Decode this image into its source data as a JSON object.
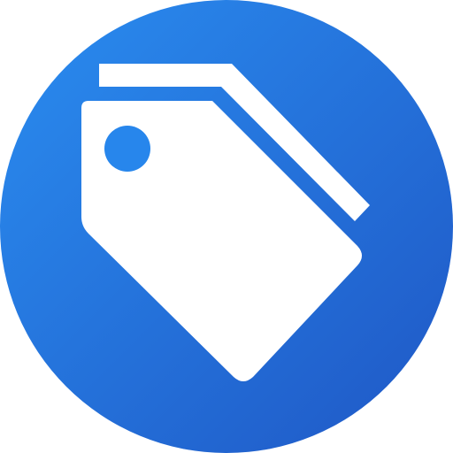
{
  "icon": {
    "name": "tags-icon",
    "description": "",
    "colors": {
      "gradient_start": "#2A8DF0",
      "gradient_end": "#1F57C5",
      "glyph": "#FFFFFF"
    }
  }
}
